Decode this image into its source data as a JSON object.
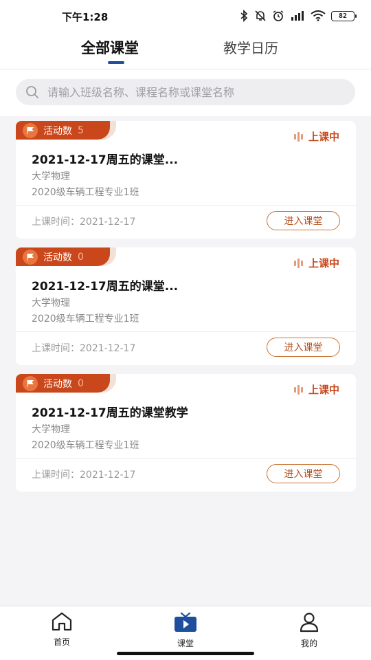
{
  "status_bar": {
    "time": "下午1:28",
    "battery": "82"
  },
  "tabs": [
    {
      "label": "全部课堂",
      "active": true
    },
    {
      "label": "教学日历",
      "active": false
    }
  ],
  "search": {
    "placeholder": "请输入班级名称、课程名称或课堂名称"
  },
  "cards": [
    {
      "badge_label": "活动数",
      "activity_count": "5",
      "status": "上课中",
      "title": "2021-12-17周五的课堂...",
      "subject": "大学物理",
      "class_name": "2020级车辆工程专业1班",
      "time_label": "上课时间：2021-12-17",
      "enter_label": "进入课堂"
    },
    {
      "badge_label": "活动数",
      "activity_count": "0",
      "status": "上课中",
      "title": "2021-12-17周五的课堂...",
      "subject": "大学物理",
      "class_name": "2020级车辆工程专业1班",
      "time_label": "上课时间：2021-12-17",
      "enter_label": "进入课堂"
    },
    {
      "badge_label": "活动数",
      "activity_count": "0",
      "status": "上课中",
      "title": "2021-12-17周五的课堂教学",
      "subject": "大学物理",
      "class_name": "2020级车辆工程专业1班",
      "time_label": "上课时间：2021-12-17",
      "enter_label": "进入课堂"
    }
  ],
  "bottom_nav": [
    {
      "label": "首页",
      "icon": "home-icon"
    },
    {
      "label": "课堂",
      "icon": "tv-icon",
      "active": true
    },
    {
      "label": "我的",
      "icon": "user-icon"
    }
  ],
  "colors": {
    "accent": "#c9471a",
    "tab_indicator": "#1f4e9c",
    "active_nav": "#1f4e9c"
  }
}
